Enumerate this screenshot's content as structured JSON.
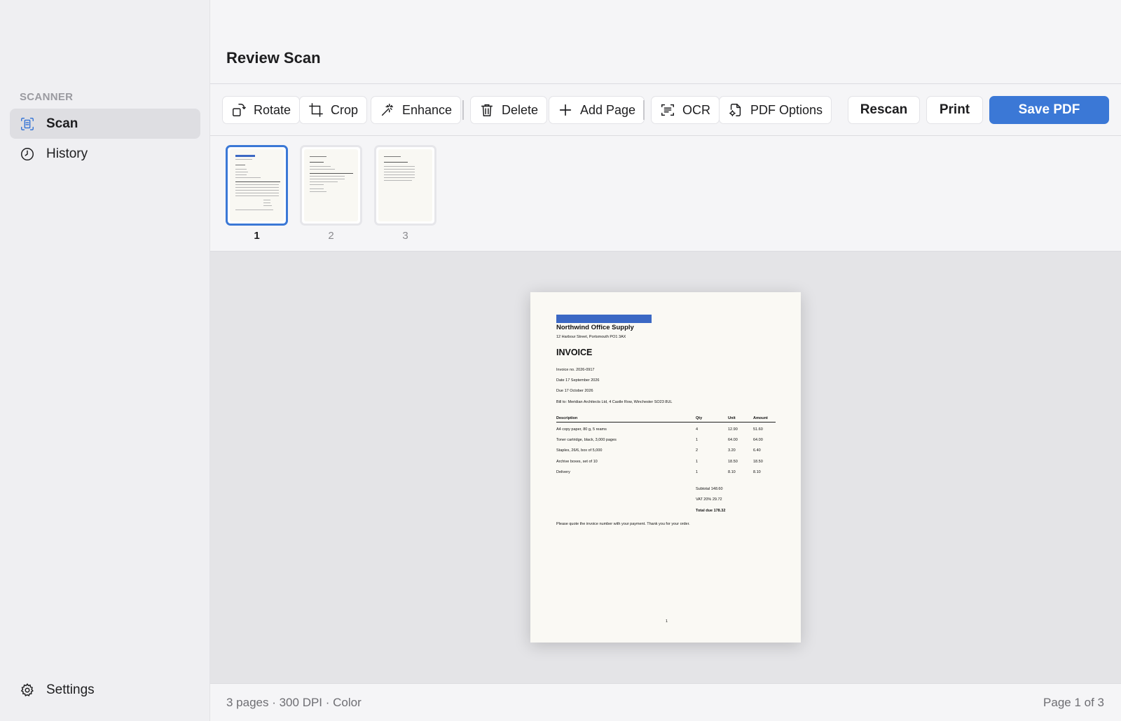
{
  "sidebar": {
    "section": "SCANNER",
    "items": [
      {
        "label": "Scan",
        "icon": "scan-icon"
      },
      {
        "label": "History",
        "icon": "clock-icon"
      }
    ],
    "settings": {
      "label": "Settings",
      "icon": "gear-icon"
    }
  },
  "header": {
    "title": "Review Scan"
  },
  "toolbar": {
    "rotate": "Rotate",
    "crop": "Crop",
    "enhance": "Enhance",
    "delete": "Delete",
    "add_page": "Add Page",
    "ocr": "OCR",
    "pdf_options": "PDF Options",
    "rescan": "Rescan",
    "print": "Print",
    "save_pdf": "Save PDF"
  },
  "thumbnails": [
    {
      "number": "1",
      "selected": true
    },
    {
      "number": "2",
      "selected": false
    },
    {
      "number": "3",
      "selected": false
    }
  ],
  "document": {
    "company": "Northwind Office Supply",
    "address": "12 Harbour Street, Portsmouth PO1 3AX",
    "title": "INVOICE",
    "invoice_no": "Invoice no. 2026-0917",
    "date": "Date 17 September 2026",
    "due": "Due 17 October 2026",
    "bill_to": "Bill to: Meridian Architects Ltd, 4 Castle Row, Winchester SO23 8UL",
    "columns": [
      "Description",
      "Qty",
      "Unit",
      "Amount"
    ],
    "rows": [
      [
        "A4 copy paper, 80 g, 5 reams",
        "4",
        "12.90",
        "51.60"
      ],
      [
        "Toner cartridge, black, 3,000 pages",
        "1",
        "64.00",
        "64.00"
      ],
      [
        "Staples, 26/6, box of 5,000",
        "2",
        "3.20",
        "6.40"
      ],
      [
        "Archive boxes, set of 10",
        "1",
        "18.50",
        "18.50"
      ],
      [
        "Delivery",
        "1",
        "8.10",
        "8.10"
      ]
    ],
    "subtotal": "Subtotal 148.60",
    "vat": "VAT 20% 29.72",
    "total": "Total due 178.32",
    "footer": "Please quote the invoice number with your payment. Thank you for your order.",
    "page_number": "1"
  },
  "status": {
    "left": "3 pages · 300 DPI · Color",
    "right": "Page 1 of 3"
  },
  "colors": {
    "accent": "#3b78d6",
    "brand_bar": "#3b68c4"
  }
}
